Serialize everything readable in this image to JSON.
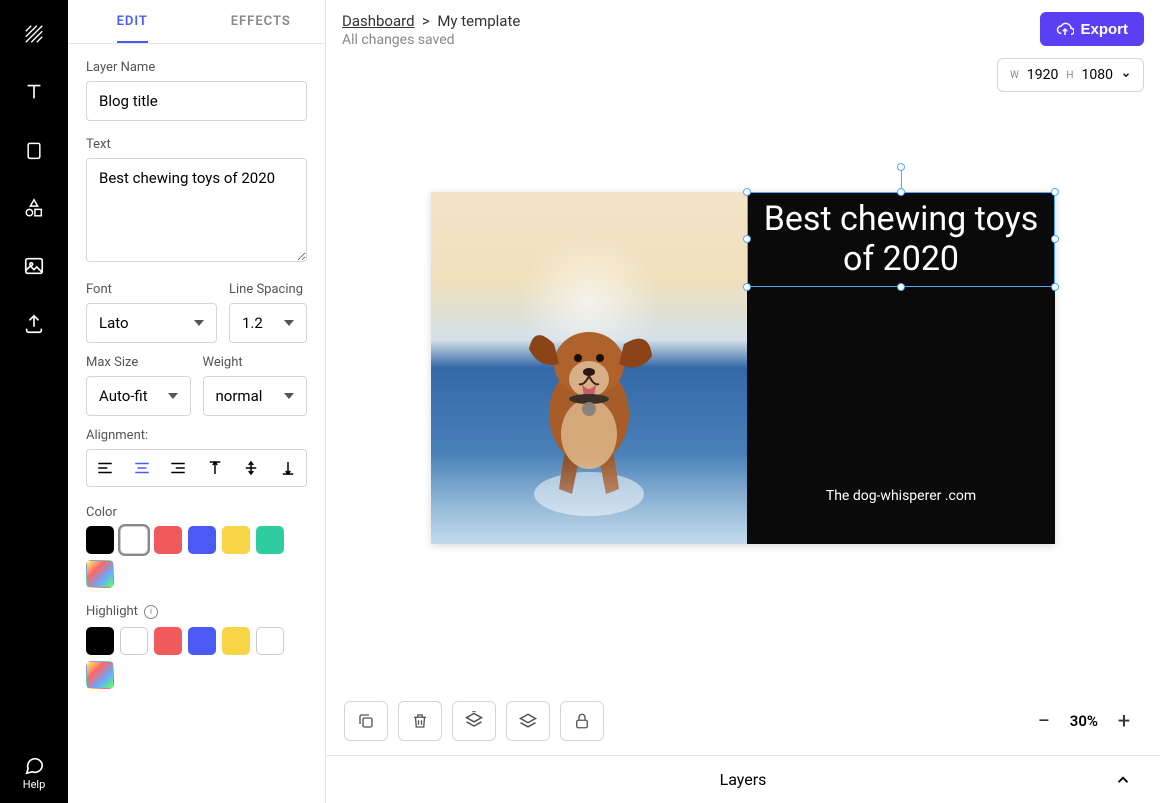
{
  "rail": {
    "help_label": "Help"
  },
  "panel": {
    "tabs": {
      "edit": "EDIT",
      "effects": "EFFECTS"
    },
    "layer_name_label": "Layer Name",
    "layer_name_value": "Blog title",
    "text_label": "Text",
    "text_value": "Best chewing toys of 2020",
    "font_label": "Font",
    "font_value": "Lato",
    "line_spacing_label": "Line Spacing",
    "line_spacing_value": "1.2",
    "max_size_label": "Max Size",
    "max_size_value": "Auto-fit",
    "weight_label": "Weight",
    "weight_value": "normal",
    "alignment_label": "Alignment:",
    "color_label": "Color",
    "highlight_label": "Highlight",
    "colors": [
      "#000000",
      "#ffffff",
      "#f15a5a",
      "#4B5AF4",
      "#f7d547",
      "#2ecc9f",
      "rainbow"
    ],
    "highlight_colors": [
      "#000000",
      "#ffffff",
      "#f15a5a",
      "#4B5AF4",
      "#f7d547",
      "#ffffff",
      "rainbow"
    ]
  },
  "header": {
    "breadcrumb_root": "Dashboard",
    "breadcrumb_sep": ">",
    "breadcrumb_current": "My template",
    "status": "All changes saved",
    "export_label": "Export",
    "width_label": "W",
    "width_value": "1920",
    "height_label": "H",
    "height_value": "1080"
  },
  "canvas": {
    "title_text": "Best chewing toys of 2020",
    "subtitle_text": "The dog-whisperer .com"
  },
  "bottom": {
    "zoom_value": "30%",
    "layers_label": "Layers"
  }
}
